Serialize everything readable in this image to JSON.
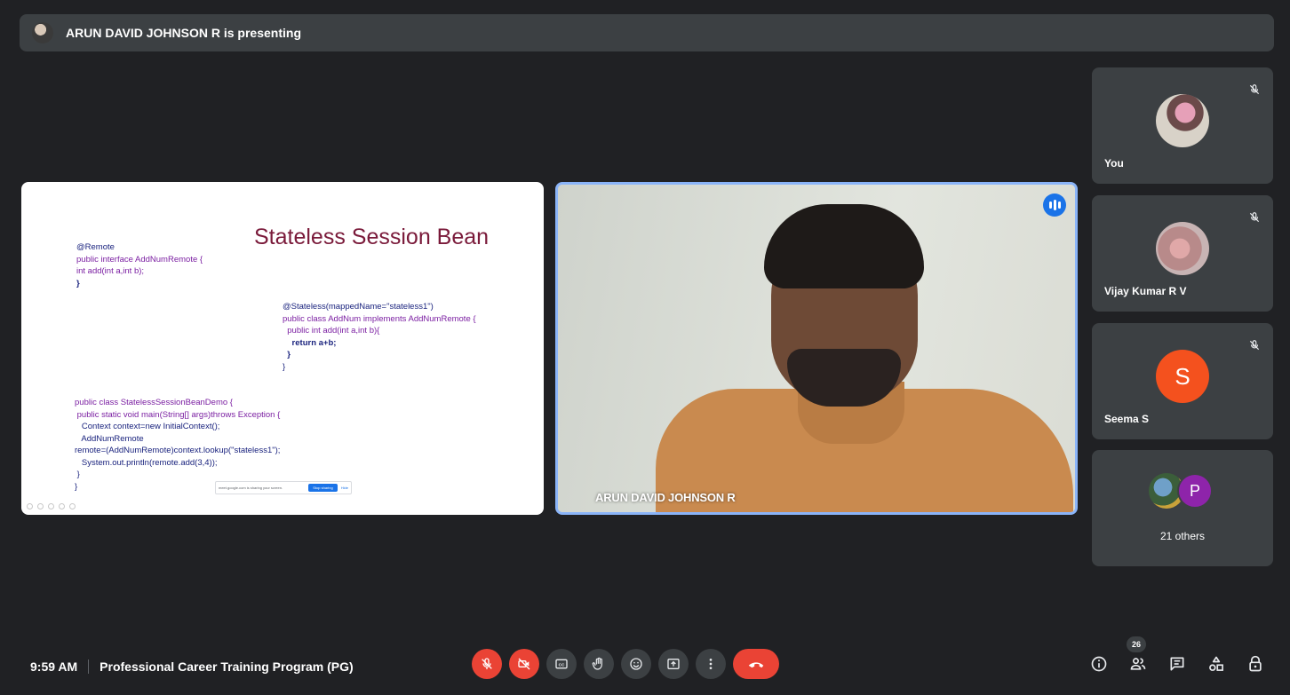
{
  "banner": {
    "presenting_text": "ARUN DAVID JOHNSON R is presenting"
  },
  "slide": {
    "title": "Stateless Session Bean",
    "interface_code": [
      "@Remote",
      "public interface AddNumRemote {",
      "int add(int a,int b);",
      "}"
    ],
    "class_code": [
      "@Stateless(mappedName=\"stateless1\")",
      "public class AddNum implements AddNumRemote {",
      "  public int add(int a,int b){",
      "    return a+b;",
      "  }",
      "}"
    ],
    "demo_code": [
      "public class StatelessSessionBeanDemo {",
      " public static void main(String[] args)throws Exception {",
      "   Context context=new InitialContext();",
      "   AddNumRemote",
      "remote=(AddNumRemote)context.lookup(\"stateless1\");",
      "   System.out.println(remote.add(3,4));",
      " }",
      "}"
    ],
    "share_bar": {
      "message": "meet.google.com is sharing your screen.",
      "stop_label": "Stop sharing",
      "hide_label": "Hide"
    }
  },
  "presenter": {
    "name": "ARUN DAVID JOHNSON R"
  },
  "participants": [
    {
      "label": "You",
      "type": "photo"
    },
    {
      "label": "Vijay Kumar R V",
      "type": "photo"
    },
    {
      "label": "Seema S",
      "type": "letter",
      "letter": "S",
      "color": "#f4511e"
    }
  ],
  "others": {
    "label": "21 others",
    "avatar_letter": "P",
    "avatar_color": "#8e24aa"
  },
  "bottom_bar": {
    "time": "9:59 AM",
    "meeting_title": "Professional Career Training Program (PG)",
    "people_count": "26"
  },
  "colors": {
    "background": "#202124",
    "tile": "#3c4043",
    "danger": "#ea4335",
    "accent": "#8ab4f8"
  }
}
